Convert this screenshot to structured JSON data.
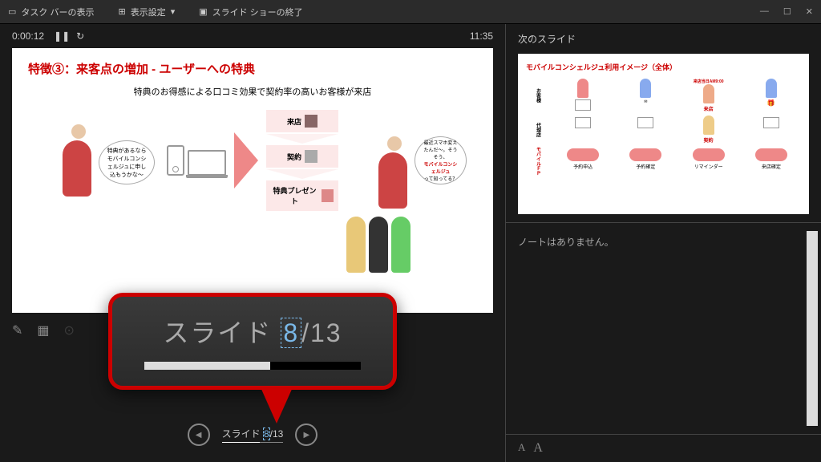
{
  "toolbar": {
    "taskbar_label": "タスク バーの表示",
    "display_settings_label": "表示設定",
    "end_slideshow_label": "スライド ショーの終了"
  },
  "timer": {
    "elapsed": "0:00:12",
    "clock": "11:35"
  },
  "current_slide": {
    "title": "特徴③：来客点の増加 - ユーザーへの特典",
    "subtitle": "特典のお得感による口コミ効果で契約率の高いお客様が来店",
    "bubble_left": "特典があるならモバイルコンシェルジュに申し込もうかな〜",
    "bubble_right_1": "最近スマホ変えたんだ〜。そうそう、",
    "bubble_right_2": "モバイルコンシェルジュ",
    "bubble_right_3": "って知ってる？",
    "flow_1": "来店",
    "flow_2": "契約",
    "flow_3": "特典プレゼント"
  },
  "next_slide_header": "次のスライド",
  "next_slide": {
    "title": "モバイルコンシェルジュ利用イメージ（全体）",
    "row_labels": [
      "お客様",
      "代理店",
      "モバイルＦＰ"
    ],
    "col_visit": "来店",
    "col_contract": "契約",
    "red_label": "来店当日AM9:00",
    "ovals": [
      "予約申込",
      "予約確定",
      "リマインダー",
      "来店確定"
    ]
  },
  "notes": {
    "empty_text": "ノートはありません。"
  },
  "nav": {
    "counter_prefix": "スライド ",
    "counter_current": "8",
    "counter_sep": "/",
    "counter_total": "13"
  },
  "callout": {
    "prefix": "スライド ",
    "current": "8",
    "sep": "/",
    "total": "13"
  },
  "font_controls": {
    "decrease": "A",
    "increase": "A"
  }
}
